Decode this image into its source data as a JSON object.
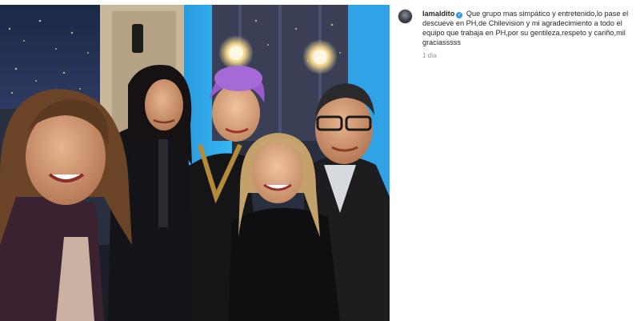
{
  "post": {
    "username": "lamaldito",
    "caption": "Que grupo mas simpático y entretenido,lo pase el descueve en PH,de Chilevision y mi agradecimiento a todo el equipo que trabaja en PH,por su gentileza,respeto y cariño,mil graciasssss",
    "time": "1 día",
    "verified": true
  },
  "icons": {
    "verified": "verified-badge-icon",
    "avatar": "profile-avatar"
  },
  "colors": {
    "verified_blue": "#3897f0",
    "text": "#262626",
    "meta": "#8e8e8e"
  }
}
